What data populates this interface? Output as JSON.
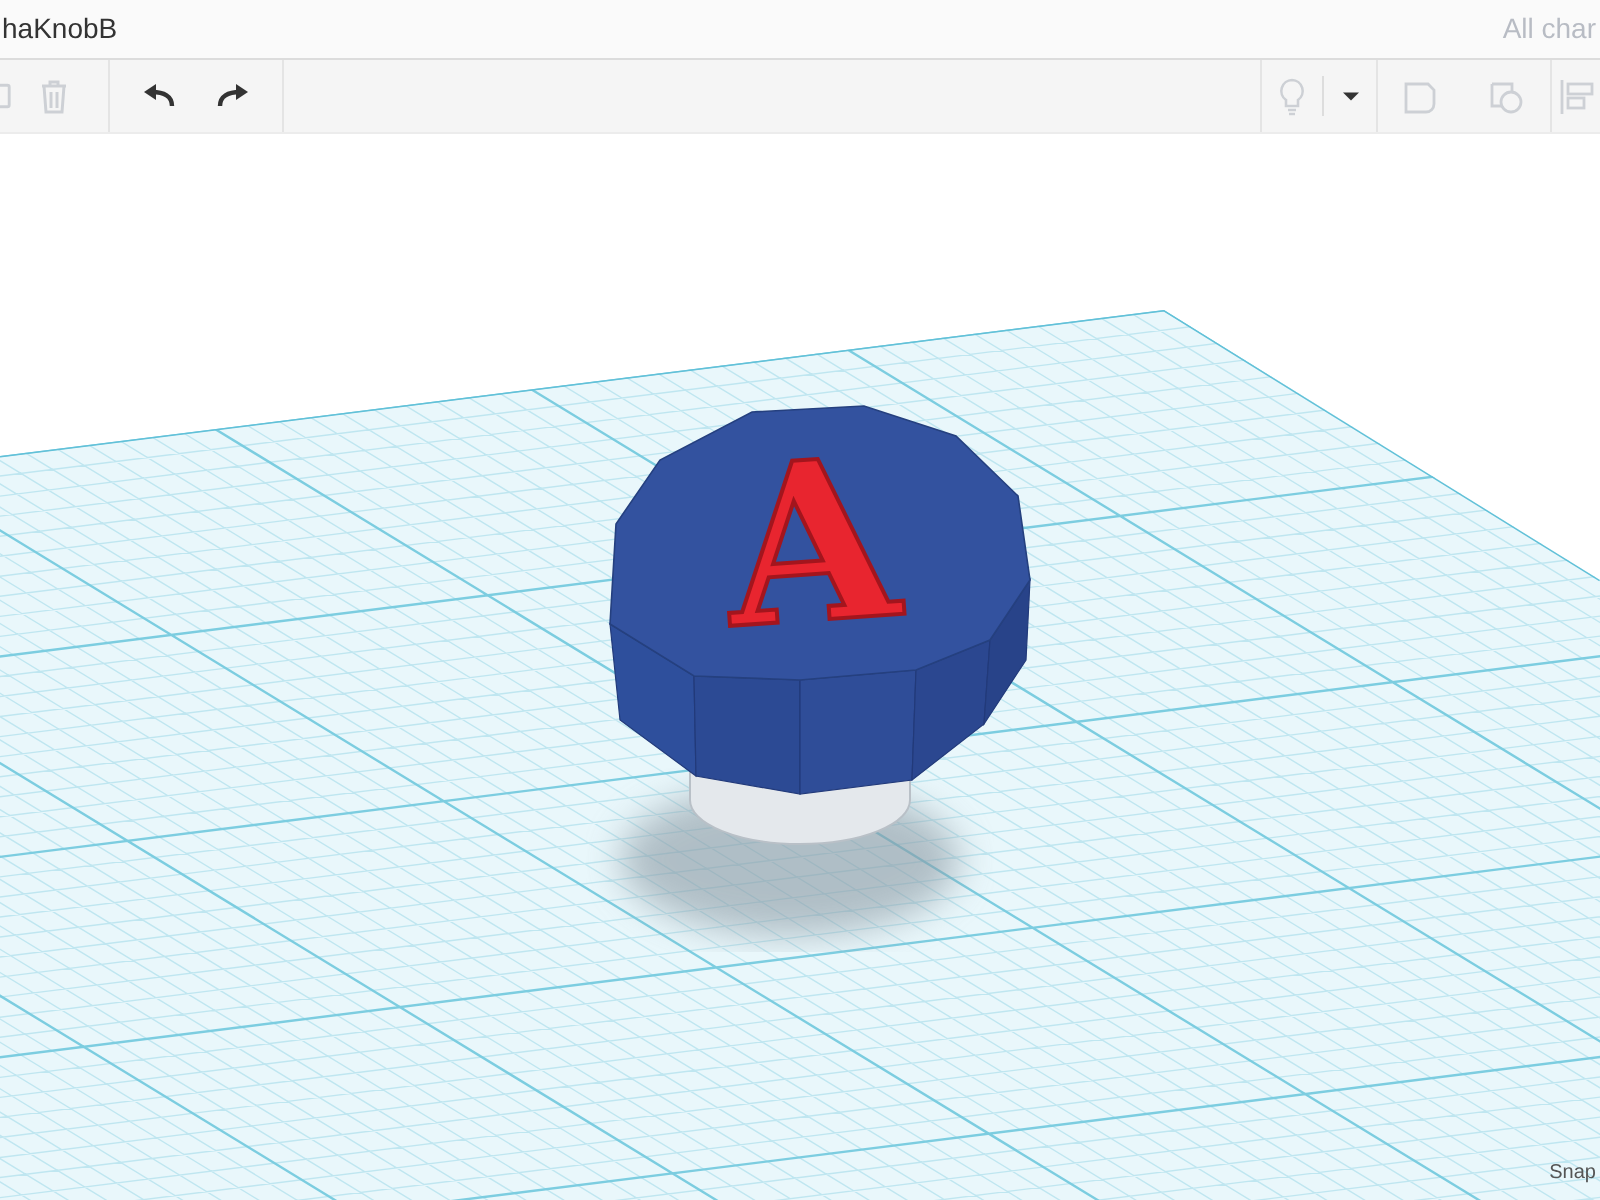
{
  "title_bar": {
    "title": "haKnobB",
    "save_status": "All char"
  },
  "toolbar": {
    "left_tools": [
      {
        "kind": "copy",
        "disabled": true
      },
      {
        "kind": "delete",
        "disabled": true
      },
      {
        "kind": "undo",
        "disabled": false
      },
      {
        "kind": "redo",
        "disabled": false
      }
    ],
    "right_tools": [
      {
        "kind": "light",
        "disabled": true
      },
      {
        "kind": "dropdown",
        "disabled": false
      },
      {
        "kind": "note",
        "disabled": true
      },
      {
        "kind": "group",
        "disabled": true
      },
      {
        "kind": "align",
        "disabled": true
      }
    ]
  },
  "workplane": {
    "model_letter": "A",
    "snap_label": "Snap"
  }
}
